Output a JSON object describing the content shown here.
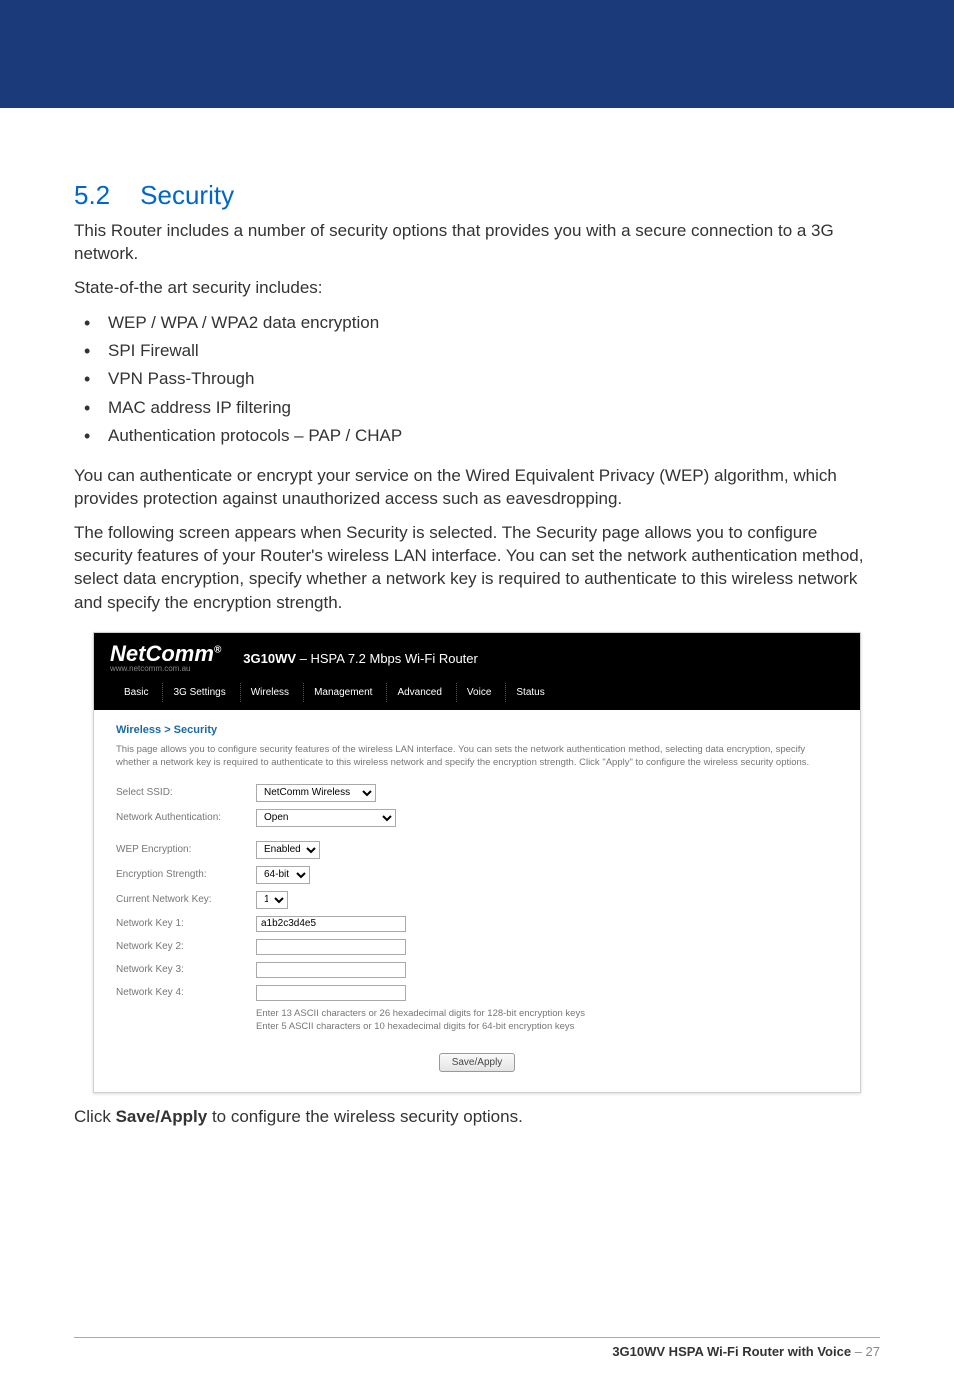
{
  "header": {
    "show_banner": true
  },
  "section": {
    "number": "5.2",
    "title": "Security"
  },
  "intro": {
    "p1": "This Router includes a number of security options that provides you with a secure connection to a 3G network.",
    "p2": "State-of-the art security includes:",
    "bullets": [
      "WEP / WPA / WPA2 data encryption",
      "SPI Firewall",
      "VPN Pass-Through",
      "MAC address IP filtering",
      "Authentication protocols – PAP / CHAP"
    ],
    "p3": "You can authenticate or encrypt your service on the Wired Equivalent Privacy (WEP) algorithm, which provides protection against unauthorized access such as eavesdropping.",
    "p4": "The following screen appears when Security is selected. The Security page allows you to configure security features of your Router's wireless LAN interface. You can set the network authentication method, select data encryption, specify whether a network key is required to authenticate to this wireless network and specify the encryption strength."
  },
  "screenshot": {
    "logo": "NetComm",
    "logo_sub": "www.netcomm.com.au",
    "product": "3G10WV",
    "product_sub": " – HSPA 7.2 Mbps Wi-Fi Router",
    "nav": [
      "Basic",
      "3G Settings",
      "Wireless",
      "Management",
      "Advanced",
      "Voice",
      "Status"
    ],
    "breadcrumb": "Wireless > Security",
    "desc": "This page allows you to configure security features of the wireless LAN interface. You can sets the network authentication method, selecting data encryption, specify whether a network key is required to authenticate to this wireless network and specify the encryption strength. Click \"Apply\" to configure the wireless security options.",
    "fields": {
      "ssid_label": "Select SSID:",
      "ssid_value": "NetComm Wireless",
      "auth_label": "Network Authentication:",
      "auth_value": "Open",
      "wep_label": "WEP Encryption:",
      "wep_value": "Enabled",
      "strength_label": "Encryption Strength:",
      "strength_value": "64-bit",
      "curkey_label": "Current Network Key:",
      "curkey_value": "1",
      "key1_label": "Network Key 1:",
      "key1_value": "a1b2c3d4e5",
      "key2_label": "Network Key 2:",
      "key2_value": "",
      "key3_label": "Network Key 3:",
      "key3_value": "",
      "key4_label": "Network Key 4:",
      "key4_value": ""
    },
    "hint1": "Enter 13 ASCII characters or 26 hexadecimal digits for 128-bit encryption keys",
    "hint2": "Enter 5 ASCII characters or 10 hexadecimal digits for 64-bit encryption keys",
    "apply_label": "Save/Apply"
  },
  "caption": {
    "prefix": "Click ",
    "bold": "Save/Apply",
    "suffix": " to configure the wireless security options."
  },
  "footer": {
    "product": "3G10WV HSPA Wi-Fi Router with Voice",
    "sep": " – ",
    "page": "27"
  }
}
